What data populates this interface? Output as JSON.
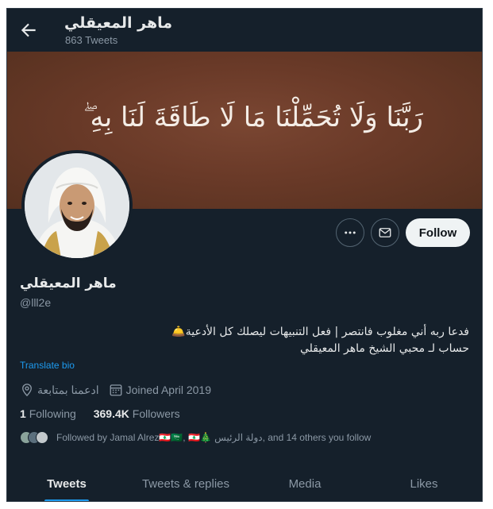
{
  "header": {
    "name": "ماهر المعيقلي",
    "tweet_count": "863 Tweets"
  },
  "banner": {
    "verse": "رَبَّنَا وَلَا تُحَمِّلْنَا مَا لَا طَاقَةَ لَنَا بِهِ ۖ"
  },
  "actions": {
    "follow_label": "Follow"
  },
  "profile": {
    "name": "ماهر المعيقلي",
    "handle": "@lll2e",
    "bio_line1": "فدعا ربه أني مغلوب فانتصر | فعل التنبيهات ليصلك كل الأدعية🛎️",
    "bio_line2": "حساب لـ محبي الشيخ ماهر المعيقلي",
    "translate_label": "Translate bio",
    "location": "ادعمنا بمتابعة",
    "joined": "Joined April 2019",
    "following_count": "1",
    "following_label": "Following",
    "followers_count": "369.4K",
    "followers_label": "Followers",
    "followed_by": "Followed by Jamal Alrez🇱🇧🇸🇦, 🇱🇧🎄 دولة الرئيس, and 14 others you follow"
  },
  "tabs": [
    {
      "label": "Tweets",
      "active": true
    },
    {
      "label": "Tweets & replies",
      "active": false
    },
    {
      "label": "Media",
      "active": false
    },
    {
      "label": "Likes",
      "active": false
    }
  ],
  "icons": {
    "back": "arrow-left-icon",
    "more": "more-dots-icon",
    "message": "envelope-icon",
    "location": "location-pin-icon",
    "calendar": "calendar-icon"
  },
  "colors": {
    "background": "#15202b",
    "accent": "#1d9bf0",
    "banner": "#6a3a28"
  }
}
